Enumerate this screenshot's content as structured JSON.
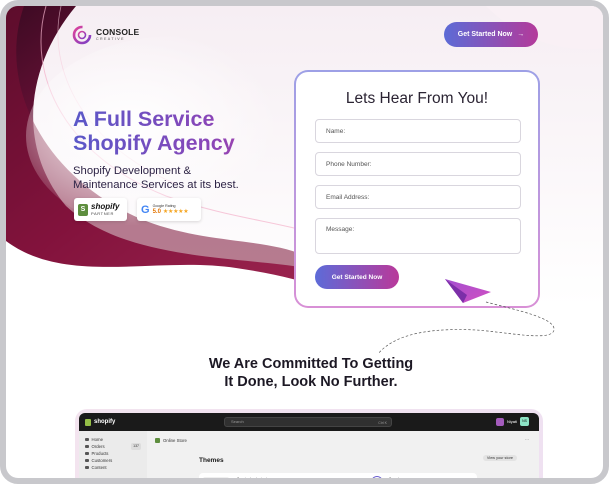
{
  "brand": {
    "name": "CONSOLE",
    "tagline": "CREATIVE"
  },
  "header": {
    "cta_label": "Get Started Now",
    "cta_arrow": "→"
  },
  "hero": {
    "headline_line1": "A Full Service",
    "headline_line2": "Shopify Agency",
    "subhead_line1": "Shopify Development &",
    "subhead_line2": "Maintenance Services at its best.",
    "badges": {
      "shopify_word": "shopify",
      "shopify_sub": "PARTNER",
      "google_label": "Google Rating",
      "google_score": "5.0",
      "google_stars": "★★★★★"
    }
  },
  "form": {
    "title": "Lets Hear From You!",
    "name_placeholder": "Name:",
    "phone_placeholder": "Phone Number:",
    "email_placeholder": "Email Address:",
    "message_placeholder": "Message:",
    "submit_label": "Get Started Now"
  },
  "section": {
    "title_line1": "We Are Committed To Getting",
    "title_line2": "It Done, Look No Further."
  },
  "admin_preview": {
    "brand": "shopify",
    "search_placeholder": "Search",
    "search_shortcut": "Ctrl K",
    "user_name": "Niyati",
    "user_initials": "NS",
    "tools": "⋯",
    "breadcrumb": "Online Store",
    "page_title": "Themes",
    "view_store_label": "View your store",
    "sidebar": [
      {
        "label": "Home",
        "count": ""
      },
      {
        "label": "Orders",
        "count": "137"
      },
      {
        "label": "Products",
        "count": ""
      },
      {
        "label": "Customers",
        "count": ""
      },
      {
        "label": "Content",
        "count": ""
      }
    ],
    "theme_card": {
      "line1": "Session by device type",
      "line2": "Speed score"
    }
  },
  "colors": {
    "accent_blue": "#5c6bd6",
    "accent_magenta": "#b43a9a",
    "hero_wave_dark": "#7d1038",
    "hero_wave_mid": "#c13d6e"
  }
}
